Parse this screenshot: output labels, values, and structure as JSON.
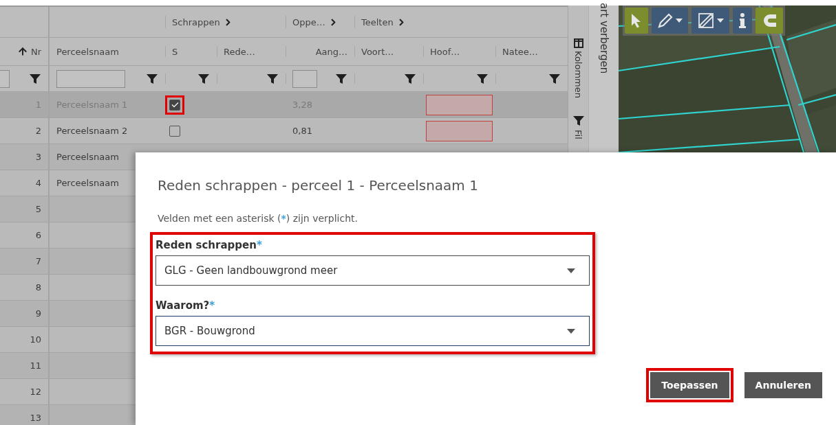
{
  "grid": {
    "group_headers": [
      {
        "label": "Schrappen"
      },
      {
        "label": "Oppe…"
      },
      {
        "label": "Teelten"
      }
    ],
    "columns": [
      {
        "label": "Nr",
        "sorted": true
      },
      {
        "label": "Perceelsnaam",
        "sorted": false
      },
      {
        "label": "S",
        "sorted": false
      },
      {
        "label": "Rede…",
        "sorted": false
      },
      {
        "label": "Aang…",
        "sorted": false
      },
      {
        "label": "Voort…",
        "sorted": false
      },
      {
        "label": "Hoof…",
        "sorted": false
      },
      {
        "label": "Natee…",
        "sorted": false
      }
    ],
    "filters": [
      {
        "kind": "cut-input"
      },
      {
        "kind": "input"
      },
      {
        "kind": "funnel"
      },
      {
        "kind": "funnel"
      },
      {
        "kind": "small-input"
      },
      {
        "kind": "funnel"
      },
      {
        "kind": "funnel"
      },
      {
        "kind": "funnel"
      }
    ],
    "rows": [
      {
        "nr": "1",
        "name": "Perceelsnaam 1",
        "checkbox": {
          "checked": true,
          "highlighted": true
        },
        "area": "3,28",
        "hoof_error": true,
        "selected": true
      },
      {
        "nr": "2",
        "name": "Perceelsnaam 2",
        "checkbox": {
          "checked": false,
          "highlighted": false
        },
        "area": "0,81",
        "hoof_error": true,
        "selected": false
      },
      {
        "nr": "3",
        "name": "Perceelsnaam",
        "selected": false
      },
      {
        "nr": "4",
        "name": "Perceelsnaam",
        "selected": false
      },
      {
        "nr": "5",
        "selected": false
      },
      {
        "nr": "6",
        "selected": false
      },
      {
        "nr": "7",
        "selected": false
      },
      {
        "nr": "8",
        "selected": false
      },
      {
        "nr": "9",
        "selected": false
      },
      {
        "nr": "10",
        "selected": false
      },
      {
        "nr": "11",
        "selected": false
      },
      {
        "nr": "12",
        "selected": false
      },
      {
        "nr": "13",
        "selected": false
      }
    ]
  },
  "side_tabs": [
    {
      "label": "Kolommen",
      "kind": "columns"
    },
    {
      "label": "Fil",
      "kind": "filter"
    }
  ],
  "map_toggle": {
    "label": "art verbergen"
  },
  "map": {
    "tools": [
      {
        "kind": "select",
        "on": true,
        "dropdown": false
      },
      {
        "kind": "draw",
        "on": false,
        "dropdown": true
      },
      {
        "kind": "measure",
        "on": false,
        "dropdown": true
      },
      {
        "kind": "info",
        "on": false,
        "dropdown": false
      },
      {
        "kind": "snap",
        "on": true,
        "dropdown": false
      }
    ]
  },
  "dialog": {
    "title": "Reden schrappen - perceel 1 - Perceelsnaam 1",
    "note": {
      "before": "Velden met een asterisk (",
      "mark": "*",
      "after": ") zijn verplicht."
    },
    "fields_highlighted": true,
    "fields": [
      {
        "label": "Reden schrappen",
        "required_mark": "*",
        "value": "GLG - Geen landbouwgrond meer",
        "focused": false
      },
      {
        "label": "Waarom?",
        "required_mark": "*",
        "value": "BGR - Bouwgrond",
        "focused": true
      }
    ],
    "buttons": [
      {
        "label": "Toepassen",
        "highlighted": true
      },
      {
        "label": "Annuleren",
        "highlighted": false
      }
    ]
  }
}
